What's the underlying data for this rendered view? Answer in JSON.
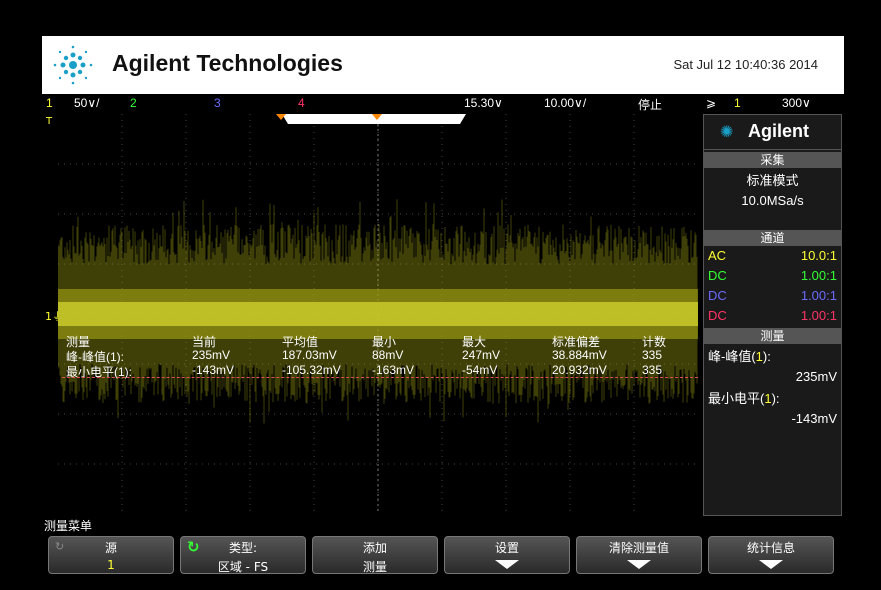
{
  "banner": {
    "brand": "Agilent Technologies",
    "timestamp": "Sat Jul 12 10:40:36 2014"
  },
  "status_bar": {
    "ch1": "1",
    "ch1_scale": "50∨/",
    "ch2": "2",
    "ch3": "3",
    "ch4": "4",
    "delay": "15.30∨",
    "timebase": "10.00∨/",
    "run_state": "停止",
    "trigger_icon": "⩾",
    "trigger_ch": "1",
    "trigger_level": "300∨",
    "colors": {
      "ch1": "#ffff33",
      "ch2": "#33ff33",
      "ch3": "#6a6aff",
      "ch4": "#ff3366"
    }
  },
  "side_panel": {
    "logo": "Agilent",
    "acquire_header": "采集",
    "acquire_mode": "标准模式",
    "sample_rate": "10.0MSa/s",
    "channels_header": "通道",
    "channels": [
      {
        "coupling": "AC",
        "probe": "10.0:1",
        "color": "#ffff33"
      },
      {
        "coupling": "DC",
        "probe": "1.00:1",
        "color": "#33ff33"
      },
      {
        "coupling": "DC",
        "probe": "1.00:1",
        "color": "#6a6aff"
      },
      {
        "coupling": "DC",
        "probe": "1.00:1",
        "color": "#ff3366"
      }
    ],
    "measure_header": "测量",
    "meas1_label_pre": "峰-峰值(",
    "meas1_label_ch": "1",
    "meas1_label_post": "):",
    "meas1_value": "235mV",
    "meas2_label_pre": "最小电平(",
    "meas2_label_ch": "1",
    "meas2_label_post": "):",
    "meas2_value": "-143mV"
  },
  "measurement_table": {
    "headers": [
      "测量",
      "当前",
      "平均值",
      "最小",
      "最大",
      "标准偏差",
      "计数"
    ],
    "rows": [
      [
        "峰-峰值(1):",
        "235mV",
        "187.03mV",
        "88mV",
        "247mV",
        "38.884mV",
        "335"
      ],
      [
        "最小电平(1):",
        "-143mV",
        "-105.32mV",
        "-163mV",
        "-54mV",
        "20.932mV",
        "335"
      ]
    ]
  },
  "softkeys": {
    "menu_title": "测量菜单",
    "keys": [
      {
        "label": "源",
        "value": "1"
      },
      {
        "label": "类型:",
        "value": "区域 - FS"
      },
      {
        "label": "添加",
        "value": "测量"
      },
      {
        "label": "设置",
        "value": ""
      },
      {
        "label": "清除测量值",
        "value": ""
      },
      {
        "label": "统计信息",
        "value": ""
      }
    ]
  }
}
